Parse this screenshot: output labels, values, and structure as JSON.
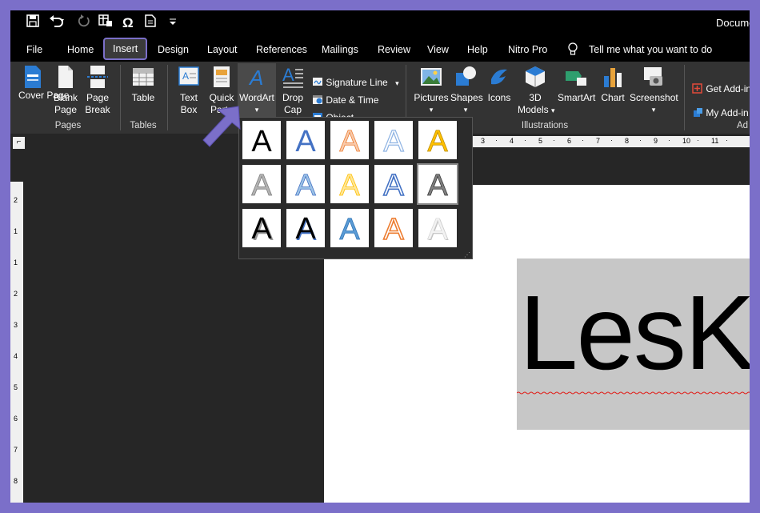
{
  "title_bar": {
    "document_title": "Docume"
  },
  "tabs": [
    "File",
    "Home",
    "Insert",
    "Design",
    "Layout",
    "References",
    "Mailings",
    "Review",
    "View",
    "Help",
    "Nitro Pro"
  ],
  "active_tab": "Insert",
  "tell_me": "Tell me what you want to do",
  "ribbon": {
    "pages": {
      "cover_page": "Cover Page",
      "blank_page": [
        "Blank",
        "Page"
      ],
      "page_break": [
        "Page",
        "Break"
      ],
      "group": "Pages"
    },
    "tables": {
      "table": "Table",
      "group": "Tables"
    },
    "text": {
      "text_box": [
        "Text",
        "Box"
      ],
      "quick_parts": [
        "Quick",
        "Parts"
      ],
      "wordart": "WordArt",
      "drop_cap": [
        "Drop",
        "Cap"
      ],
      "signature_line": "Signature Line",
      "date_time": "Date & Time",
      "object": "Object"
    },
    "illustrations": {
      "pictures": "Pictures",
      "shapes": "Shapes",
      "icons": "Icons",
      "models_3d": [
        "3D",
        "Models"
      ],
      "smartart": "SmartArt",
      "chart": "Chart",
      "screenshot": "Screenshot",
      "group": "Illustrations"
    },
    "addins": {
      "get_addins": "Get Add-in",
      "my_addins": "My Add-in",
      "group": "Ad"
    }
  },
  "ruler": {
    "h_labels": [
      "3",
      "4",
      "5",
      "6",
      "7",
      "8",
      "9",
      "10",
      "11"
    ],
    "v_labels": [
      "2",
      "1",
      "1",
      "2",
      "3",
      "4",
      "5",
      "6",
      "7",
      "8"
    ]
  },
  "document": {
    "text": "LesK"
  },
  "colors": {
    "accent": "#7b6fc9",
    "wordart_blue": "#4472c4",
    "wordart_orange": "#ed7d31",
    "wordart_gold": "#ffc000"
  }
}
